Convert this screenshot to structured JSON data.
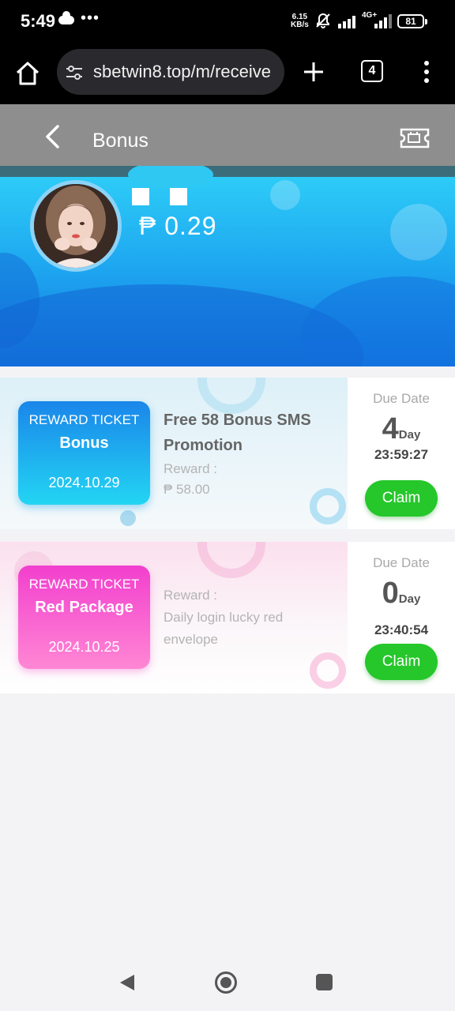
{
  "status_bar": {
    "time": "5:49",
    "more": "•••",
    "speed_value": "6.15",
    "speed_unit": "KB/s",
    "network": "4G+",
    "battery": "81"
  },
  "browser": {
    "url": "sbetwin8.top/m/receive",
    "tab_count": "4"
  },
  "header": {
    "title": "Bonus"
  },
  "profile": {
    "balance": "₱ 0.29"
  },
  "tickets": [
    {
      "badge_label": "REWARD TICKET",
      "badge_name": "Bonus",
      "date": "2024.10.29",
      "title": "Free 58 Bonus SMS Promotion",
      "reward_label": "Reward :",
      "reward_value": "₱ 58.00",
      "due_label": "Due Date",
      "days": "4",
      "days_unit": "Day",
      "time_left": "23:59:27",
      "claim_label": "Claim"
    },
    {
      "badge_label": "REWARD TICKET",
      "badge_name": "Red Package",
      "date": "2024.10.25",
      "reward_label": "Reward :",
      "reward_value": "Daily login lucky red envelope",
      "due_label": "Due Date",
      "days": "0",
      "days_unit": "Day",
      "time_left": "23:40:54",
      "claim_label": "Claim"
    }
  ],
  "colors": {
    "claim_green": "#25c72a",
    "banner_blue": "#1ea7f0",
    "badge_blue": "#1a86ea",
    "badge_pink": "#f23fce",
    "header_gray": "#8e8e8e"
  },
  "icons": [
    "cloud-icon",
    "mute-icon",
    "signal-icon",
    "battery-icon",
    "home-icon",
    "site-settings-icon",
    "plus-icon",
    "tabs-icon",
    "more-vert-icon",
    "back-arrow-icon",
    "ticket-icon",
    "nav-back-icon",
    "nav-home-icon",
    "nav-recents-icon"
  ]
}
